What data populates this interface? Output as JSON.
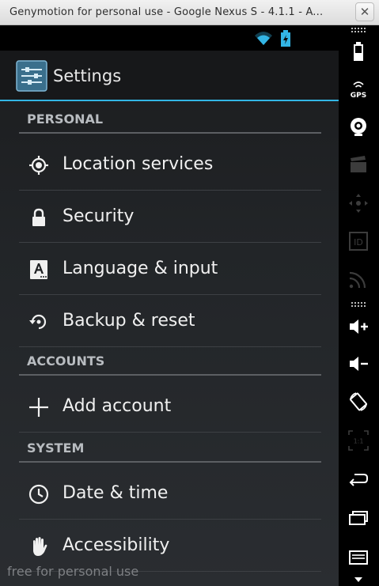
{
  "window": {
    "title": "Genymotion for personal use - Google Nexus S - 4.1.1 - A...",
    "close_glyph": "✕"
  },
  "statusbar": {
    "icons": [
      "wifi-icon",
      "battery-charging-icon"
    ],
    "accent": "#33b5e5"
  },
  "actionbar": {
    "title": "Settings",
    "icon": "settings-app-icon",
    "accent": "#33b5e5"
  },
  "sections": [
    {
      "header": "PERSONAL",
      "items": [
        {
          "label": "Location services",
          "icon": "location-icon"
        },
        {
          "label": "Security",
          "icon": "lock-icon"
        },
        {
          "label": "Language & input",
          "icon": "language-icon"
        },
        {
          "label": "Backup & reset",
          "icon": "backup-icon"
        }
      ]
    },
    {
      "header": "ACCOUNTS",
      "items": [
        {
          "label": "Add account",
          "icon": "plus-icon"
        }
      ]
    },
    {
      "header": "SYSTEM",
      "items": [
        {
          "label": "Date & time",
          "icon": "clock-icon"
        },
        {
          "label": "Accessibility",
          "icon": "hand-icon"
        }
      ]
    }
  ],
  "watermark": "free for personal use",
  "sidebar": {
    "buttons": [
      "battery-icon",
      "gps-icon",
      "camera-icon",
      "video-icon",
      "dpad-icon",
      "id-icon",
      "rss-icon",
      "volume-up-icon",
      "volume-down-icon",
      "rotate-icon",
      "scale-icon",
      "back-icon",
      "recent-apps-icon",
      "menu-icon"
    ],
    "gps_label": "GPS",
    "id_label": "ID",
    "scale_label": "1:1"
  }
}
